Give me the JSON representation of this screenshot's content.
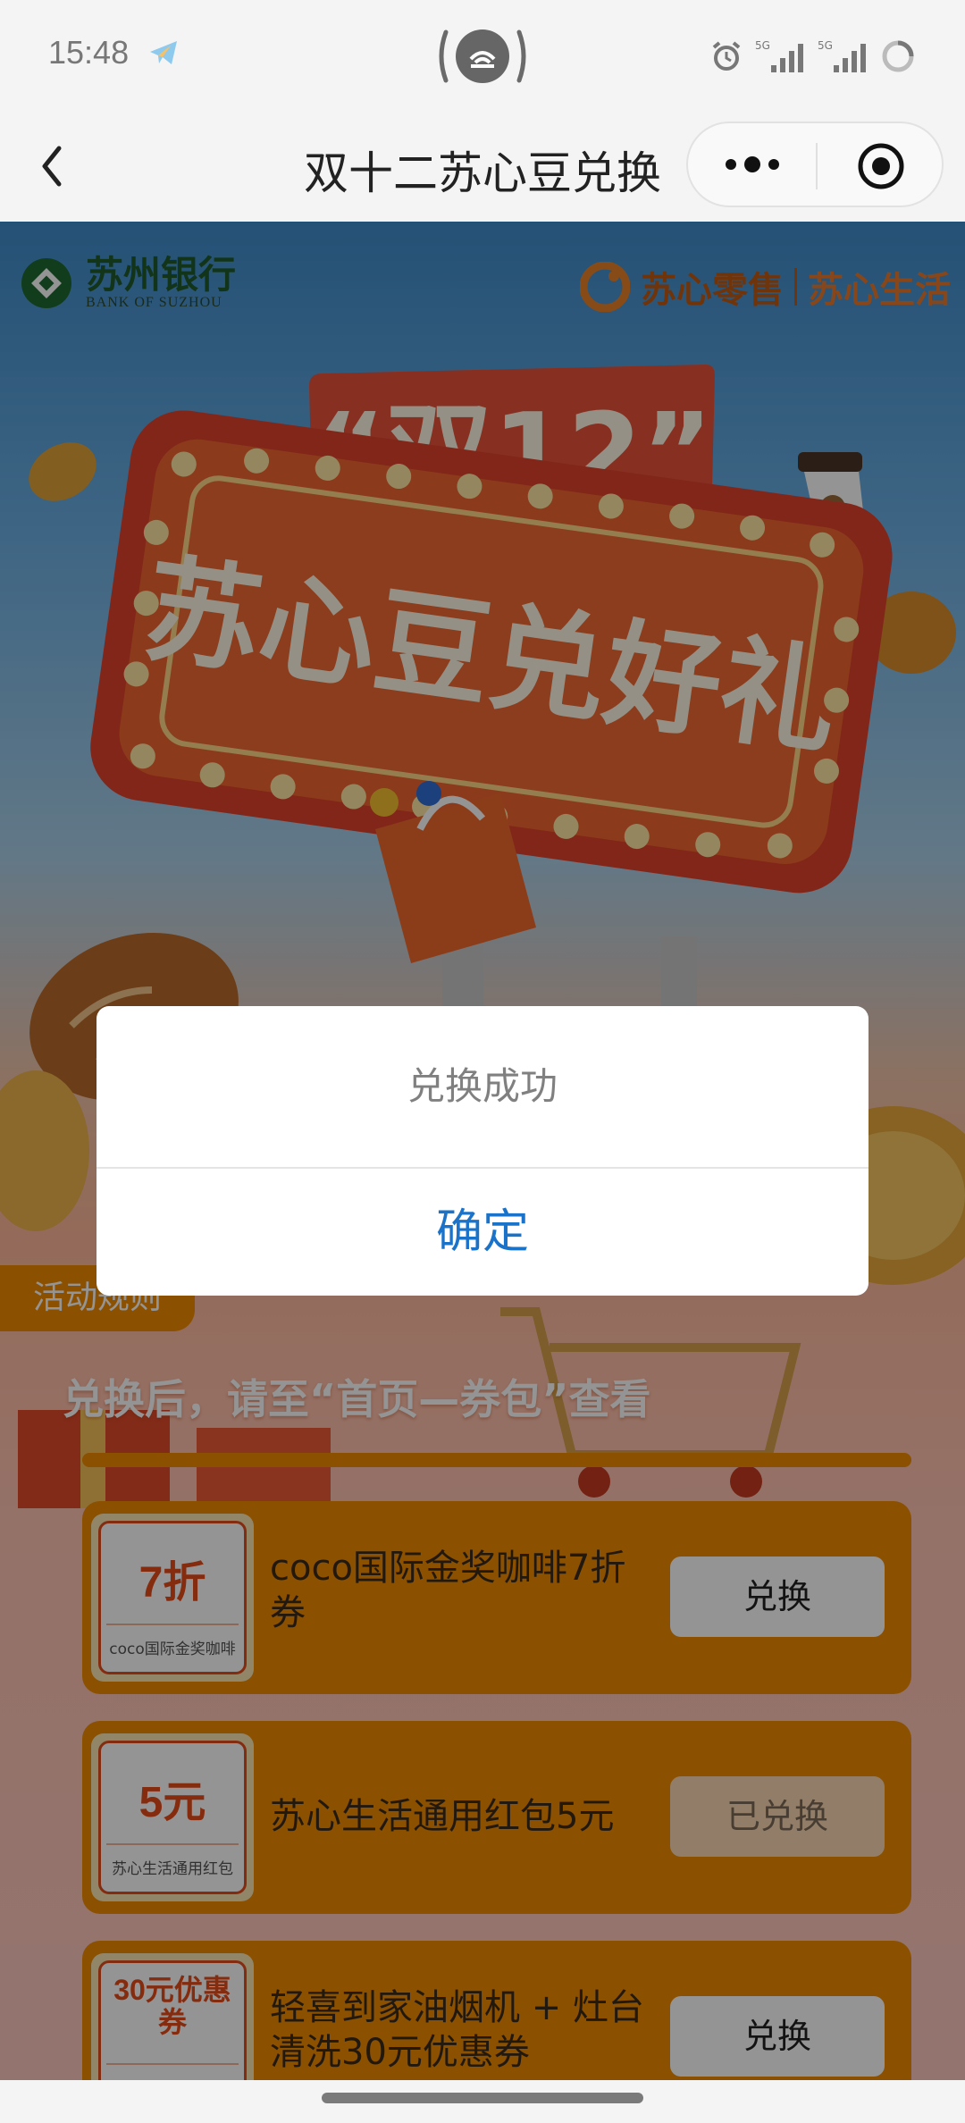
{
  "status_bar": {
    "time": "15:48",
    "icons": [
      "telegram-icon",
      "hotspot-icon",
      "alarm-icon",
      "signal-5g-icon",
      "signal-5g-icon",
      "battery-icon"
    ],
    "network_1": "5G",
    "network_2": "5G"
  },
  "nav": {
    "title": "双十二苏心豆兑换",
    "back_icon": "chevron-left-icon",
    "more_icon": "more-dots-icon",
    "close_icon": "target-icon"
  },
  "banner": {
    "bank_name": "苏州银行",
    "bank_subtitle": "BANK OF SUZHOU",
    "retail_brand": "苏心零售",
    "life_brand": "苏心生活",
    "sign_top": "“双12”",
    "sign_main": "苏心豆兑好礼"
  },
  "rules_label": "活动规则",
  "hint": "兑换后，请至“首页—券包”查看",
  "items": [
    {
      "badge": "7折",
      "caption": "coco国际金奖咖啡",
      "title": "coco国际金奖咖啡7折券",
      "button": "兑换",
      "state": "available"
    },
    {
      "badge": "5元",
      "caption": "苏心生活通用红包",
      "title": "苏心生活通用红包5元",
      "button": "已兑换",
      "state": "redeemed"
    },
    {
      "badge": "30元优惠券",
      "caption": "",
      "title": "轻喜到家油烟机 + 灶台清洗30元优惠券",
      "button": "兑换",
      "state": "available"
    }
  ],
  "dialog": {
    "message": "兑换成功",
    "confirm": "确定"
  },
  "colors": {
    "accent_orange": "#f08a00",
    "coupon_red": "#e64a19",
    "confirm_blue": "#1a73c8",
    "sign_red": "#e8543a"
  }
}
